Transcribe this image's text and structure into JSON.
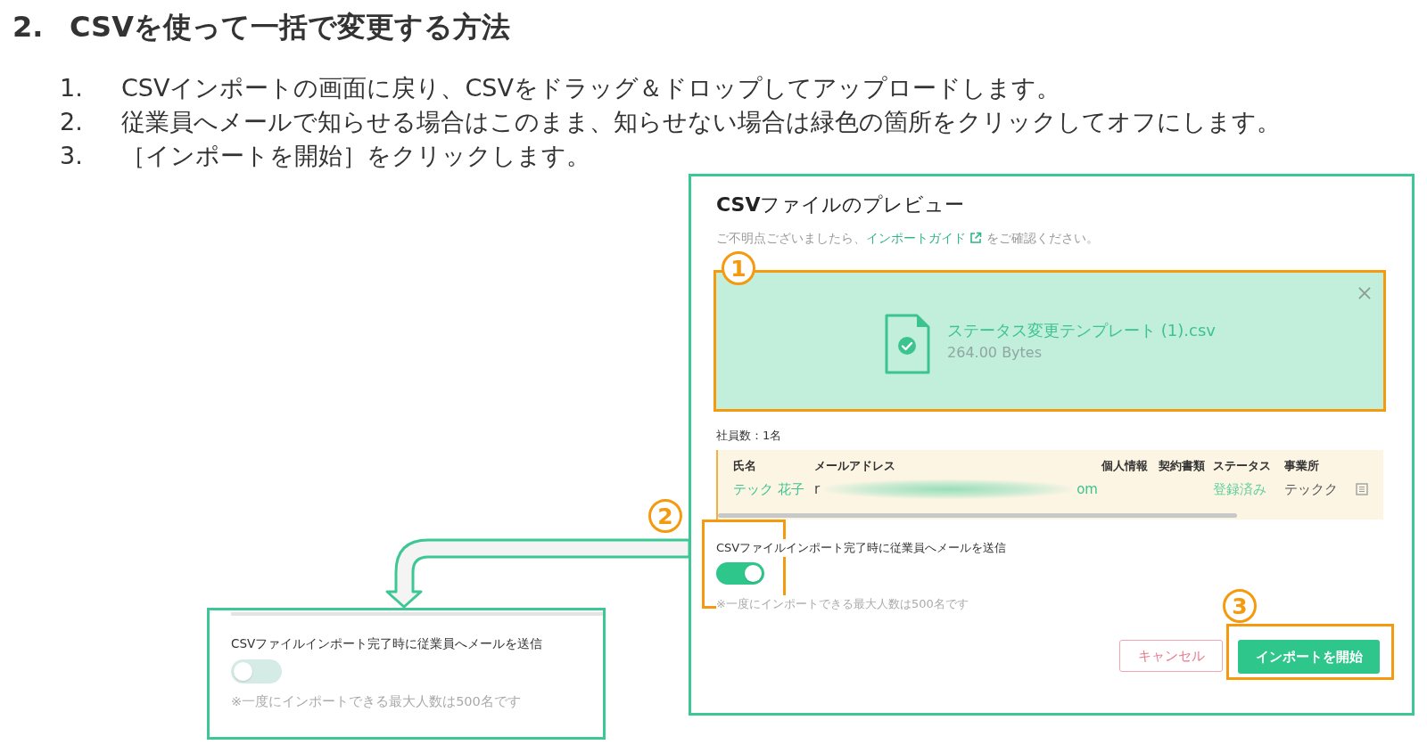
{
  "heading": {
    "number": "2.",
    "title": "CSVを使って一括で変更する方法"
  },
  "steps": [
    {
      "number": "1.",
      "text": "CSVインポートの画面に戻り、CSVをドラッグ＆ドロップしてアップロードします。"
    },
    {
      "number": "2.",
      "text": "従業員へメールで知らせる場合はこのまま、知らせない場合は緑色の箇所をクリックしてオフにします。"
    },
    {
      "number": "3.",
      "text": "［インポートを開始］をクリックします。"
    }
  ],
  "preview_dialog": {
    "title": "**CSV**ファイルのプレビュー",
    "guide": {
      "before": "ご不明点ございましたら、",
      "link": "インポートガイド",
      "after": "をご確認ください。"
    },
    "file": {
      "name": "ステータス変更テンプレート (1).csv",
      "size": "264.00 Bytes",
      "highlighted": true,
      "callout": "1"
    },
    "employee_count": "社員数：1名",
    "table": {
      "columns": [
        "氏名",
        "メールアドレス",
        "個人情報",
        "契約書類",
        "ステータス",
        "事業所"
      ],
      "rows": [
        {
          "name": "テック 花子",
          "email_start": "r",
          "email_end": "om",
          "status": "登録済み",
          "office": "テックク"
        }
      ]
    },
    "notify_toggle": {
      "label": "CSVファイルインポート完了時に従業員へメールを送信",
      "on": true,
      "note": "※一度にインポートできる最大人数は500名です",
      "highlighted": true,
      "callout": "2"
    },
    "buttons": [
      {
        "label": "キャンセル",
        "kind": "secondary",
        "highlighted": false
      },
      {
        "label": "インポートを開始",
        "kind": "primary",
        "highlighted": true,
        "callout": "3"
      }
    ]
  },
  "zoomed_toggle": {
    "label": "CSVファイルインポート完了時に従業員へメールを送信",
    "on": false,
    "note": "※一度にインポートできる最大人数は500名です"
  }
}
